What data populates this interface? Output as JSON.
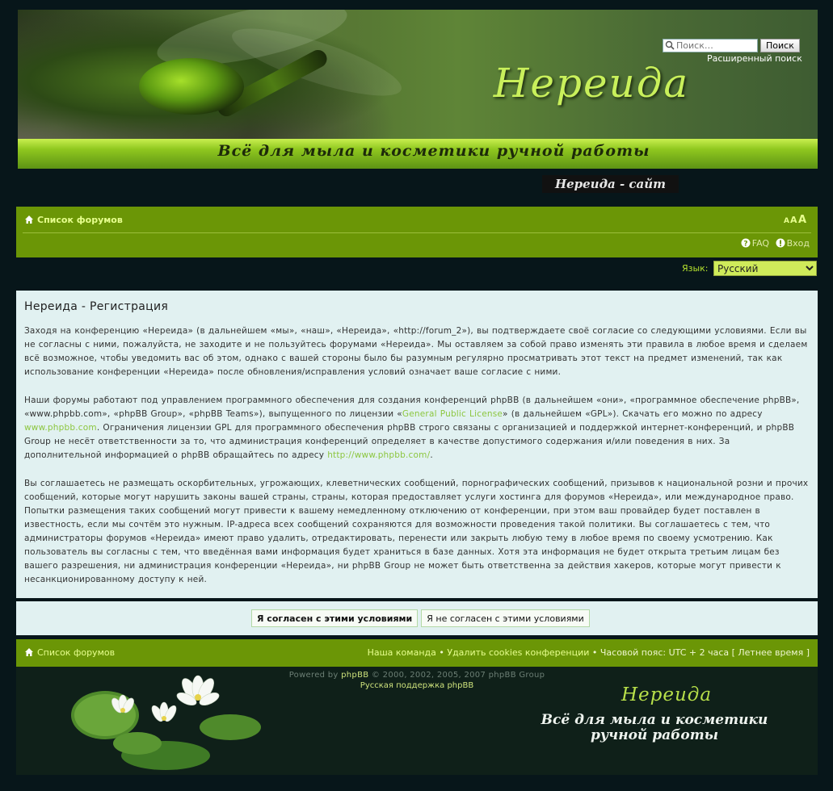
{
  "header": {
    "logo_text": "Нереида",
    "tagline": "Всё для мыла и косметики ручной работы",
    "search_placeholder": "Поиск…",
    "search_button": "Поиск",
    "advanced_search": "Расширенный поиск",
    "site_link": "Нереида - сайт"
  },
  "navbar": {
    "forum_index": "Список форумов",
    "faq": "FAQ",
    "login": "Вход"
  },
  "language": {
    "label": "Язык:",
    "selected": "Русский"
  },
  "panel": {
    "title": "Нереида - Регистрация",
    "p1": "Заходя на конференцию «Нереида» (в дальнейшем «мы», «наш», «Нереида», «http://forum_2»), вы подтверждаете своё согласие со следующими условиями. Если вы не согласны с ними, пожалуйста, не заходите и не пользуйтесь форумами «Нереида». Мы оставляем за собой право изменять эти правила в любое время и сделаем всё возможное, чтобы уведомить вас об этом, однако с вашей стороны было бы разумным регулярно просматривать этот текст на предмет изменений, так как использование конференции «Нереида» после обновления/исправления условий означает ваше согласие с ними.",
    "p2_a": "Наши форумы работают под управлением программного обеспечения для создания конференций phpBB (в дальнейшем «они», «программное обеспечение phpBB», «www.phpbb.com», «phpBB Group», «phpBB Teams»), выпущенного по лицензии «",
    "p2_link1": "General Public License",
    "p2_b": "» (в дальнейшем «GPL»). Скачать его можно по адресу ",
    "p2_link2": "www.phpbb.com",
    "p2_c": ". Ограничения лицензии GPL для программного обеспечения phpBB строго связаны с организацией и поддержкой интернет-конференций, и phpBB Group не несёт ответственности за то, что администрация конференций определяет в качестве допустимого содержания и/или поведения в них. За дополнительной информацией о phpBB обращайтесь по адресу ",
    "p2_link3": "http://www.phpbb.com/",
    "p2_d": ".",
    "p3": "Вы соглашаетесь не размещать оскорбительных, угрожающих, клеветнических сообщений, порнографических сообщений, призывов к национальной розни и прочих сообщений, которые могут нарушить законы вашей страны, страны, которая предоставляет услуги хостинга для форумов «Нереида», или международное право. Попытки размещения таких сообщений могут привести к вашему немедленному отключению от конференции, при этом ваш провайдер будет поставлен в известность, если мы сочтём это нужным. IP-адреса всех сообщений сохраняются для возможности проведения такой политики. Вы соглашаетесь с тем, что администраторы форумов «Нереида» имеют право удалить, отредактировать, перенести или закрыть любую тему в любое время по своему усмотрению. Как пользователь вы согласны с тем, что введённая вами информация будет храниться в базе данных. Хотя эта информация не будет открыта третьим лицам без вашего разрешения, ни администрация конференции «Нереида», ни phpBB Group не может быть ответственна за действия хакеров, которые могут привести к несанкционированному доступу к ней."
  },
  "buttons": {
    "agree": "Я согласен с этими условиями",
    "disagree": "Я не согласен с этими условиями"
  },
  "footnav": {
    "forum_index": "Список форумов",
    "team": "Наша команда",
    "sep": " • ",
    "delete_cookies": "Удалить cookies конференции",
    "timezone": "Часовой пояс: UTC + 2 часа [ Летнее время ]"
  },
  "footer": {
    "powered_prefix": "Powered by ",
    "powered_link": "phpBB",
    "powered_suffix": " © 2000, 2002, 2005, 2007 phpBB Group",
    "ru_support": "Русская поддержка phpBB",
    "logo_text": "Нереида",
    "tagline": "Всё для мыла и косметики ручной работы"
  },
  "colors": {
    "page_bg": "#07161a",
    "nav_green": "#6b9606",
    "panel_bg": "#e1f1f1",
    "link_green": "#8cc63f",
    "nav_link": "#e7ff8e"
  }
}
